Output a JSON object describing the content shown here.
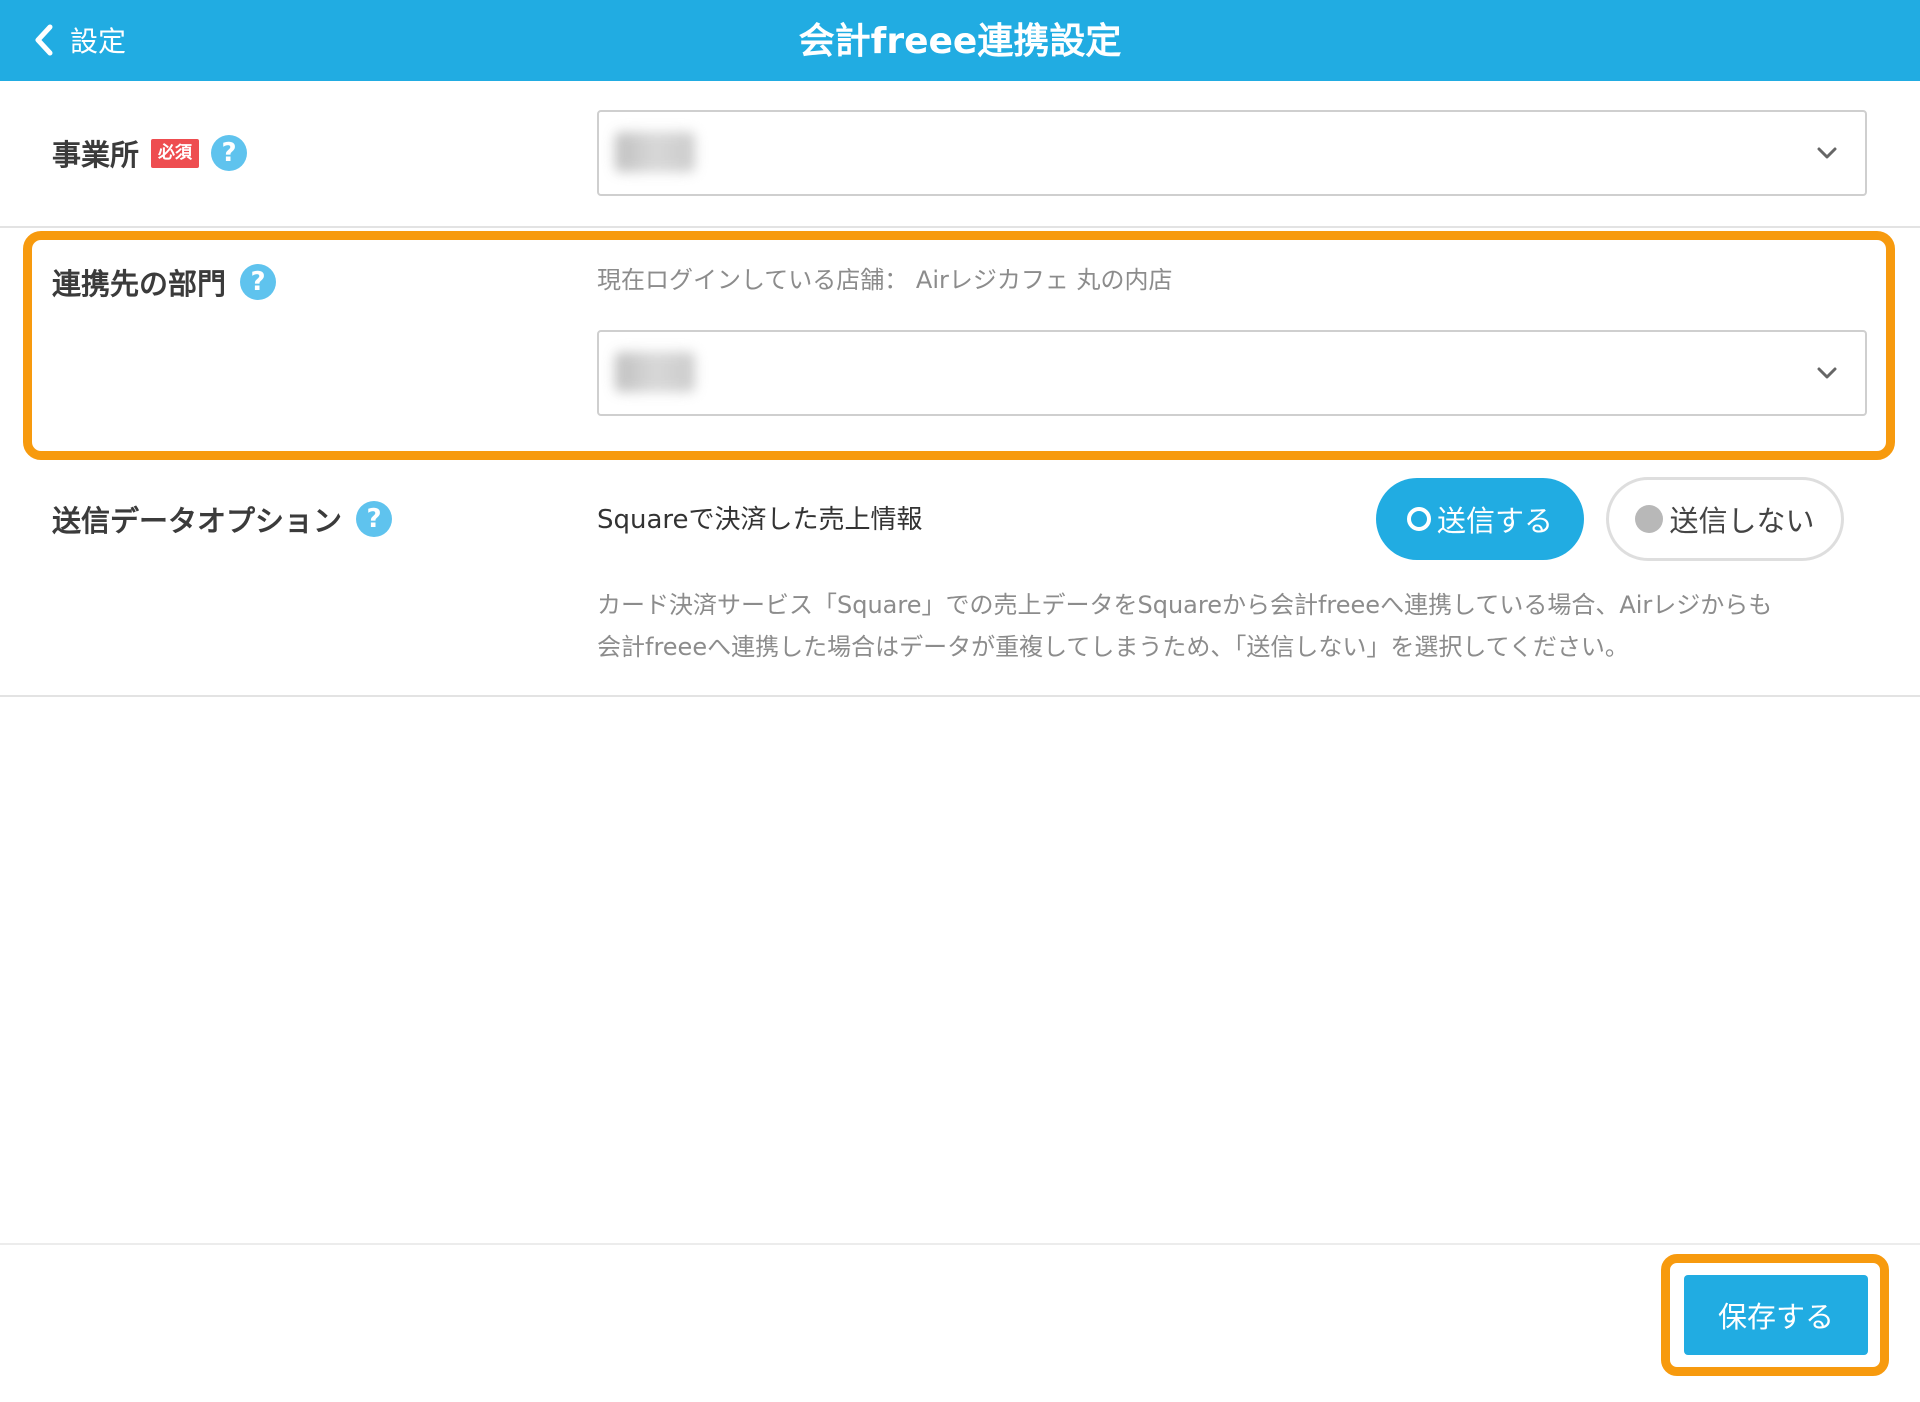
{
  "header": {
    "back_label": "設定",
    "title": "会計freee連携設定"
  },
  "office": {
    "label": "事業所",
    "required_badge": "必須",
    "help_icon": "?",
    "select_value_note": "blurred"
  },
  "department": {
    "label": "連携先の部門",
    "help_icon": "?",
    "current_store_label": "現在ログインしている店舗： Airレジカフェ 丸の内店",
    "select_value_note": "blurred"
  },
  "send_option": {
    "label": "送信データオプション",
    "help_icon": "?",
    "item_label": "Squareで決済した売上情報",
    "option_send": "送信する",
    "option_no_send": "送信しない",
    "selected": "送信する",
    "note_line1": "カード決済サービス「Square」での売上データをSquareから会計freeeへ連携している場合、Airレジからも",
    "note_line2": "会計freeeへ連携した場合はデータが重複してしまうため、「送信しない」を選択してください。"
  },
  "footer": {
    "save_label": "保存する"
  },
  "colors": {
    "brand": "#21ace2",
    "highlight": "#f79a0e",
    "required": "#ee4d50",
    "help": "#5fc3ee"
  },
  "icons": {
    "back": "chevron-left-icon",
    "dropdown": "chevron-down-icon",
    "help": "question-circle-icon"
  }
}
